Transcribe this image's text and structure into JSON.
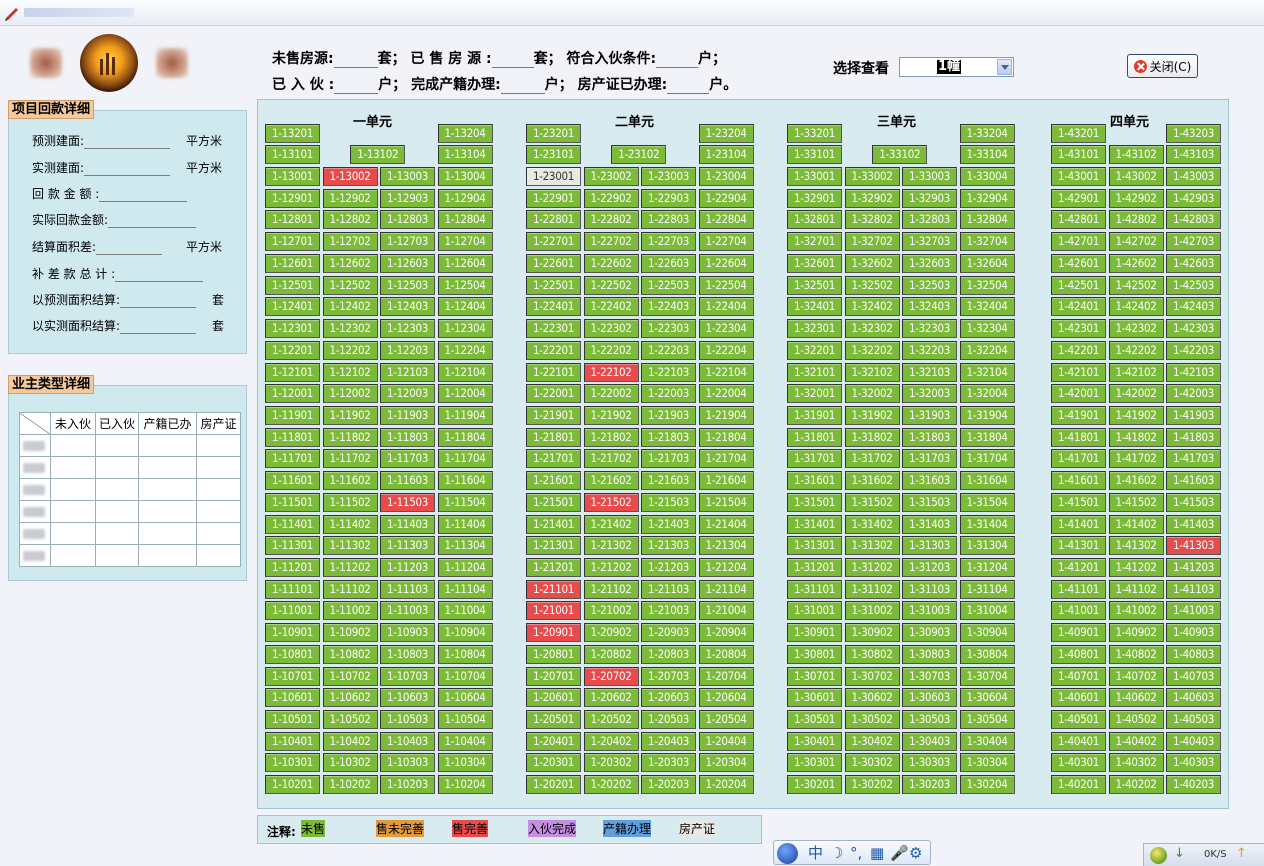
{
  "header": {
    "stats_line1": [
      {
        "label": "未售房源:",
        "suffix": "套；"
      },
      {
        "label": "已 售 房 源 :",
        "suffix": "套；"
      },
      {
        "label": "符合入伙条件:",
        "suffix": "户；"
      }
    ],
    "stats_line2": [
      {
        "label": "已 入 伙 :",
        "suffix": "户；"
      },
      {
        "label": "完成产籍办理:",
        "suffix": "户；"
      },
      {
        "label": "房产证已办理:",
        "suffix": "户。"
      }
    ],
    "view_label": "选择查看",
    "building_value": "1幢",
    "close_label": "关闭(C)"
  },
  "payment_panel": {
    "title": "项目回款详细",
    "rows": [
      {
        "label": "预测建面:",
        "unit": "平方米"
      },
      {
        "label": "实测建面:",
        "unit": "平方米"
      },
      {
        "label": "回 款 金 额 :",
        "unit": ""
      },
      {
        "label": "实际回款金额:",
        "unit": ""
      },
      {
        "label": "结算面积差:",
        "unit": "平方米"
      },
      {
        "label": "补 差 款 总 计 :",
        "unit": ""
      },
      {
        "label": "以预测面积结算:",
        "unit": "套"
      },
      {
        "label": "以实测面积结算:",
        "unit": "套"
      }
    ]
  },
  "owner_panel": {
    "title": "业主类型详细",
    "columns": [
      "未入伙",
      "已入伙",
      "产籍已办",
      "房产证"
    ],
    "row_count": 6
  },
  "units": [
    {
      "name": "一单元",
      "prefix": "1-1",
      "top_floor": 32,
      "special_rows": {
        "32": [
          "01",
          "",
          "",
          "04"
        ],
        "31": [
          "01",
          "02",
          "",
          "04"
        ]
      },
      "sold": [
        "1-13002",
        "1-11503"
      ]
    },
    {
      "name": "二单元",
      "prefix": "1-2",
      "top_floor": 32,
      "special_rows": {
        "32": [
          "01",
          "",
          "",
          "04"
        ],
        "31": [
          "01",
          "02",
          "",
          "04"
        ]
      },
      "sold": [
        "1-22102",
        "1-21502",
        "1-21101",
        "1-21001",
        "1-20901",
        "1-20702"
      ],
      "other": [
        "1-23001"
      ]
    },
    {
      "name": "三单元",
      "prefix": "1-3",
      "top_floor": 32,
      "special_rows": {
        "32": [
          "01",
          "",
          "",
          "04"
        ],
        "31": [
          "01",
          "02",
          "",
          "04"
        ]
      },
      "sold": []
    },
    {
      "name": "四单元",
      "prefix": "1-4",
      "top_floor": 32,
      "cols": 3,
      "special_rows": {
        "32": [
          "01",
          "",
          "03"
        ]
      },
      "sold": [
        "1-41303"
      ]
    }
  ],
  "legend": {
    "label": "注释:",
    "items": [
      {
        "text": "未售",
        "color": "#7cba3a"
      },
      {
        "text": "售未完善",
        "color": "#e29a3b"
      },
      {
        "text": "售完善",
        "color": "#e84b4b"
      },
      {
        "text": "入伙完成",
        "color": "#c58ee3"
      },
      {
        "text": "产籍办理",
        "color": "#5f9fe0"
      },
      {
        "text": "房产证",
        "color": "#e9e9e4"
      }
    ]
  },
  "ime": {
    "chars": [
      "中",
      "☽",
      "°,",
      "▦",
      "🎤",
      "⚙"
    ]
  },
  "tray": {
    "rate": "0K/S"
  }
}
